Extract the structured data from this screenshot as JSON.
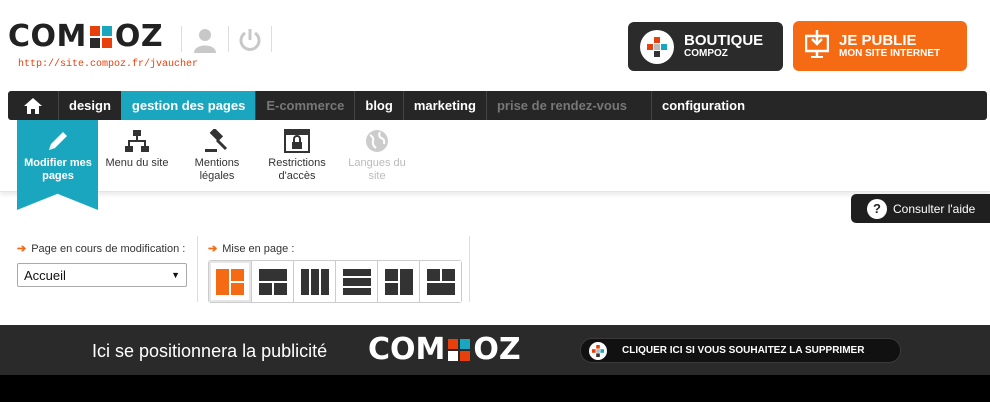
{
  "header": {
    "logo_left": "COM",
    "logo_right": "OZ",
    "site_url": "http://site.compoz.fr/jvaucher",
    "user_icon": "user-icon",
    "power_icon": "power-icon",
    "boutique": {
      "title": "BOUTIQUE",
      "subtitle": "COMPOZ"
    },
    "publie": {
      "title": "JE PUBLIE",
      "subtitle": "MON SITE INTERNET"
    }
  },
  "nav": {
    "home_icon": "home-icon",
    "items": [
      {
        "label": "design"
      },
      {
        "label": "gestion des pages"
      },
      {
        "label": "E-commerce"
      },
      {
        "label": "blog"
      },
      {
        "label": "marketing"
      },
      {
        "label": "prise de rendez-vous"
      },
      {
        "label": "configuration"
      }
    ]
  },
  "toolbar": {
    "items": [
      {
        "label": "Modifier mes pages",
        "icon": "pencil-icon"
      },
      {
        "label": "Menu du site",
        "icon": "sitemap-icon"
      },
      {
        "label": "Mentions légales",
        "icon": "gavel-icon"
      },
      {
        "label": "Restrictions d'accès",
        "icon": "lock-window-icon"
      },
      {
        "label": "Langues du site",
        "icon": "globe-icon"
      }
    ]
  },
  "help": {
    "label": "Consulter l'aide",
    "icon": "question-icon"
  },
  "options": {
    "page_label": "Page en cours de modification :",
    "page_value": "Accueil",
    "layout_label": "Mise en page :",
    "layouts": [
      "layout-1-icon",
      "layout-2-icon",
      "layout-3-icon",
      "layout-4-icon",
      "layout-5-icon",
      "layout-6-icon"
    ]
  },
  "ad": {
    "text": "Ici se positionnera la publicité",
    "logo_left": "COM",
    "logo_right": "OZ",
    "button": "CLIQUER ICI SI VOUS SOUHAITEZ LA SUPPRIMER"
  },
  "colors": {
    "accent": "#1ba6c0",
    "orange": "#f46b14",
    "dark": "#262626"
  }
}
